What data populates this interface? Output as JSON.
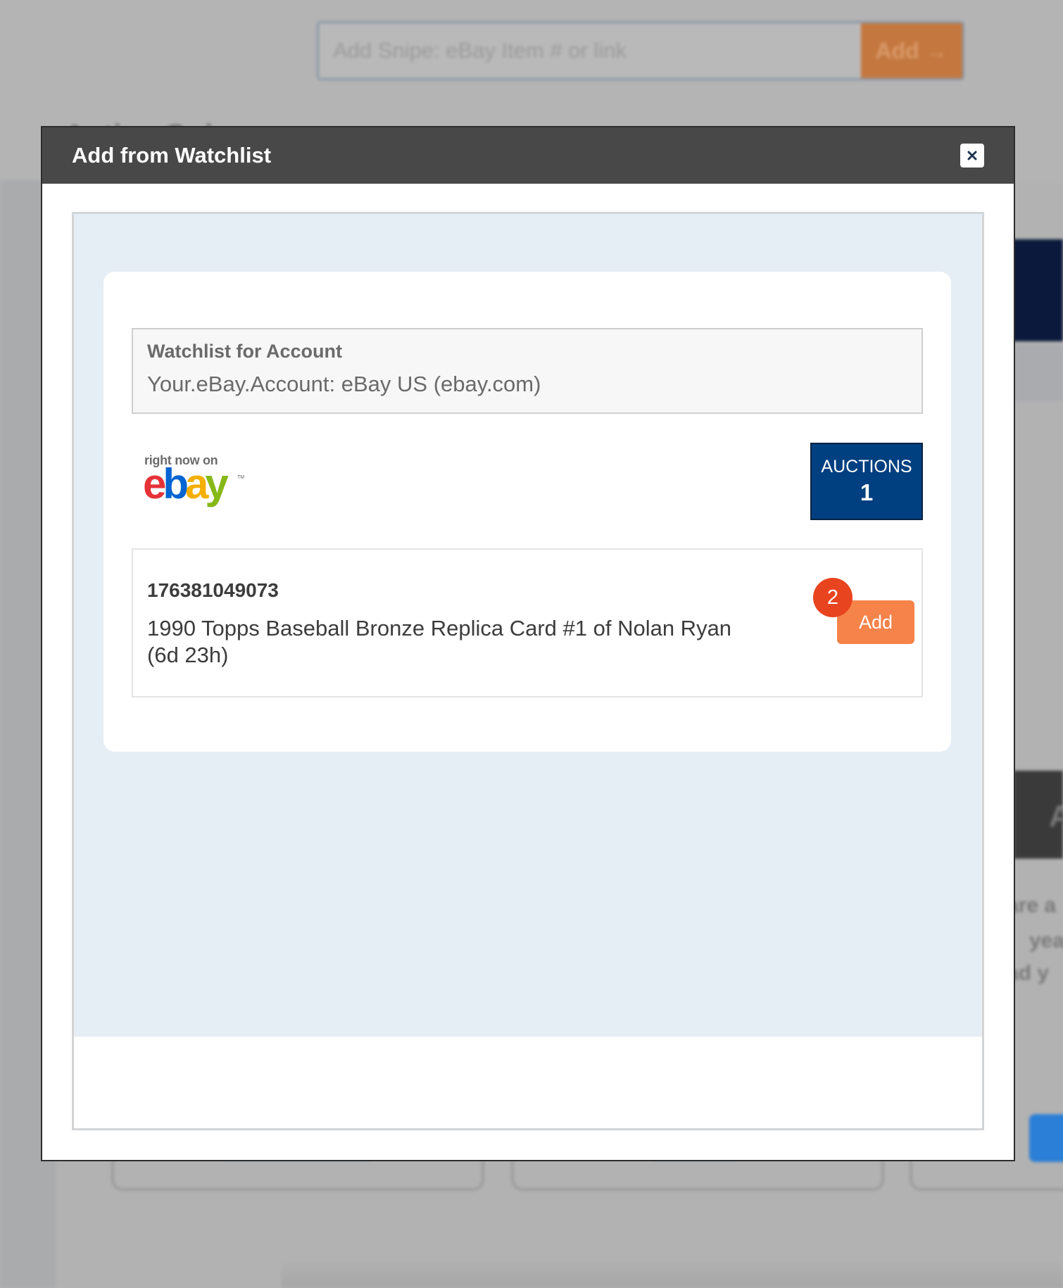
{
  "background": {
    "snipe": {
      "placeholder": "Add Snipe: eBay Item # or link",
      "button_label": "Add"
    },
    "heading": "Active Snipes",
    "right_dark_text": "A",
    "right_text_lines": [
      "are a",
      "yea",
      "ad y"
    ]
  },
  "modal": {
    "title": "Add from Watchlist",
    "close_icon": "close-icon",
    "account": {
      "label": "Watchlist for Account",
      "value": "Your.eBay.Account: eBay US (ebay.com)"
    },
    "logo": {
      "tagline": "right now on",
      "wordmark": "ebay",
      "wordmark_colors": [
        "#e53238",
        "#0064d2",
        "#f5af02",
        "#86b817"
      ]
    },
    "auctions": {
      "label": "AUCTIONS",
      "count": "1"
    },
    "items": [
      {
        "id": "176381049073",
        "title": "1990 Topps Baseball Bronze Replica Card #1 of Nolan Ryan (6d 23h)",
        "button_label": "Add",
        "step_badge": "2"
      }
    ]
  },
  "colors": {
    "header_bg": "#484848",
    "accent_orange": "#f5834a",
    "badge_red": "#e8441f",
    "auctions_bg": "#003f80",
    "panel_bg": "#e6eef5"
  }
}
